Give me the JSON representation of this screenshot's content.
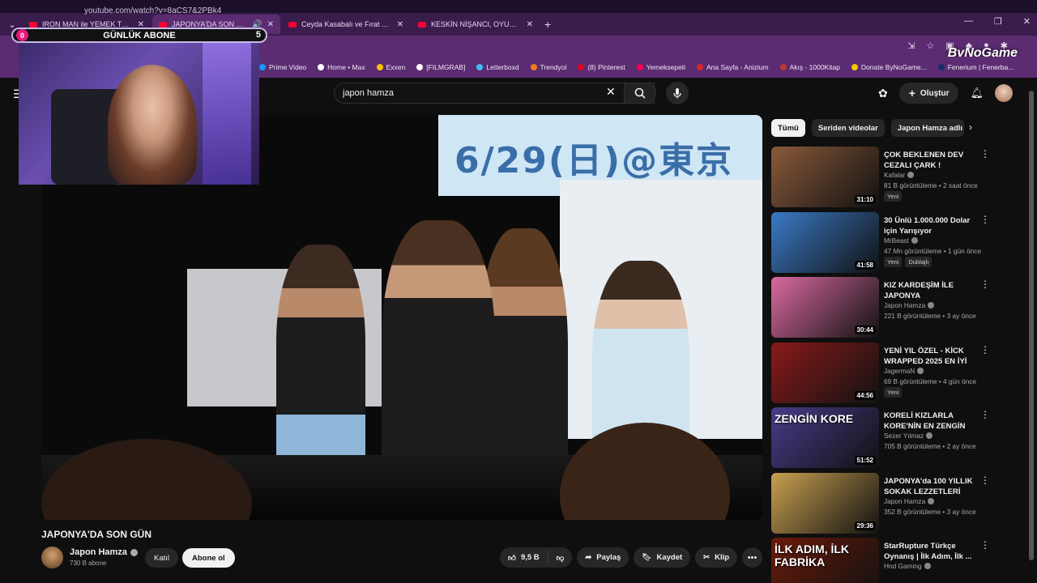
{
  "browser": {
    "tabs": [
      {
        "title": "IRON MAN ile YEMEK TURU! - Y",
        "active": false
      },
      {
        "title": "JAPONYA'DA SON GÜN - Y",
        "active": true
      },
      {
        "title": "Ceyda Kasabalı ve Fırat Albayra",
        "active": false
      },
      {
        "title": "KESKİN NİŞANCI, OYUNLARDA",
        "active": false
      }
    ],
    "new_tab": "+",
    "url": "youtube.com/watch?v=8aCS7&2PBk4",
    "bookmarks": [
      {
        "label": "Prime Video",
        "color": "#1a98ff"
      },
      {
        "label": "Home • Max",
        "color": "#ffffff"
      },
      {
        "label": "Exxen",
        "color": "#f5c400"
      },
      {
        "label": "[FILMGRAB]",
        "color": "#ffffff"
      },
      {
        "label": "Letterboxd",
        "color": "#40bcf4"
      },
      {
        "label": "Trendyol",
        "color": "#f27a1a"
      },
      {
        "label": "(8) Pinterest",
        "color": "#e60023"
      },
      {
        "label": "Yemeksepeti",
        "color": "#fa0050"
      },
      {
        "label": "Ana Sayfa - Anizium",
        "color": "#d62828"
      },
      {
        "label": "Akış - 1000Kitap",
        "color": "#c0392b"
      },
      {
        "label": "Donate ByNoGame...",
        "color": "#f5c400"
      },
      {
        "label": "Fenerium | Fenerba...",
        "color": "#1b2a6b"
      }
    ],
    "brand_overlay": "ByNoGame"
  },
  "stream_overlay": {
    "subs_label": "GÜNLÜK ABONE",
    "subs_left": "0",
    "subs_right": "5"
  },
  "youtube": {
    "search_query": "japon hamza",
    "create_label": "Oluştur",
    "video": {
      "title": "JAPONYA'DA SON GÜN",
      "scene_text": "6/29(日)@東京",
      "channel": "Japon Hamza",
      "subs": "730 B abone",
      "join": "Katıl",
      "subscribe": "Abone ol",
      "likes": "9,5 B",
      "share": "Paylaş",
      "save": "Kaydet",
      "clip": "Klip"
    },
    "chips": [
      "Tümü",
      "Seriden videolar",
      "Japon Hamza adlı yü"
    ],
    "recommendations": [
      {
        "title": "ÇOK BEKLENEN DEV CEZALI ÇARK !",
        "channel": "Kafalar",
        "meta": "81 B görüntüleme • 2 saat önce",
        "duration": "31:10",
        "badges": [
          "Yeni"
        ],
        "thumb_color": "#8a5a3a"
      },
      {
        "title": "30 Ünlü 1.000.000 Dolar için Yarışıyor",
        "channel": "MrBeast",
        "meta": "47 Mn görüntüleme • 1 gün önce",
        "duration": "41:58",
        "badges": [
          "Yeni",
          "Dublajlı"
        ],
        "thumb_color": "#3a7ac8"
      },
      {
        "title": "KIZ KARDEŞİM İLE JAPONYA",
        "channel": "Japon Hamza",
        "meta": "221 B görüntüleme • 3 ay önce",
        "duration": "30:44",
        "badges": [],
        "thumb_color": "#d96aa0"
      },
      {
        "title": "YENİ YIL ÖZEL - KİCK WRAPPED 2025 EN İYİ ...",
        "channel": "JagermaN",
        "meta": "69 B görüntüleme • 4 gün önce",
        "duration": "44:56",
        "badges": [
          "Yeni"
        ],
        "thumb_color": "#8a1a1a"
      },
      {
        "title": "KORELİ KIZLARLA KORE'NİN EN ZENGİN ...",
        "channel": "Sezer Yılmaz",
        "meta": "705 B görüntüleme • 2 ay önce",
        "duration": "51:52",
        "badges": [],
        "thumb_color": "#4a3a8a",
        "thumb_text": "ZENGİN KORE"
      },
      {
        "title": "JAPONYA'da 100 YILLIK SOKAK LEZZETLERİ",
        "channel": "Japon Hamza",
        "meta": "352 B görüntüleme • 3 ay önce",
        "duration": "29:36",
        "badges": [],
        "thumb_color": "#c8a050"
      },
      {
        "title": "StarRupture Türkçe Oynanış | İlk Adım, İlk ...",
        "channel": "Hnd Gaming",
        "meta": "",
        "duration": "",
        "badges": [],
        "thumb_color": "#6a1a0a",
        "thumb_text": "İLK ADIM, İLK FABRİKA"
      }
    ]
  }
}
